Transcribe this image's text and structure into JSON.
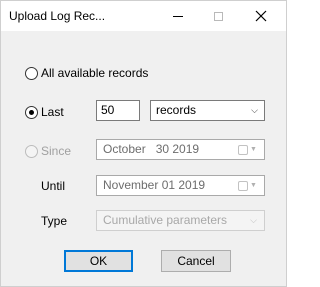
{
  "window": {
    "title": "Upload Log Rec..."
  },
  "options": {
    "all_records_label": "All available records",
    "last_label": "Last",
    "last_value": "50",
    "last_unit": "records",
    "since_label": "Since",
    "since_date": "October   30 2019",
    "until_label": "Until",
    "until_date": "November 01 2019",
    "type_label": "Type",
    "type_value": "Cumulative parameters",
    "selected": "Last"
  },
  "buttons": {
    "ok": "OK",
    "cancel": "Cancel"
  },
  "icons": {
    "minimize": "minimize-icon",
    "maximize": "maximize-icon",
    "close": "close-icon",
    "calendar": "calendar-icon",
    "dropdown": "chevron-down-icon"
  },
  "colors": {
    "default_button_border": "#0078d7",
    "dialog_background": "#f0f0f0"
  }
}
